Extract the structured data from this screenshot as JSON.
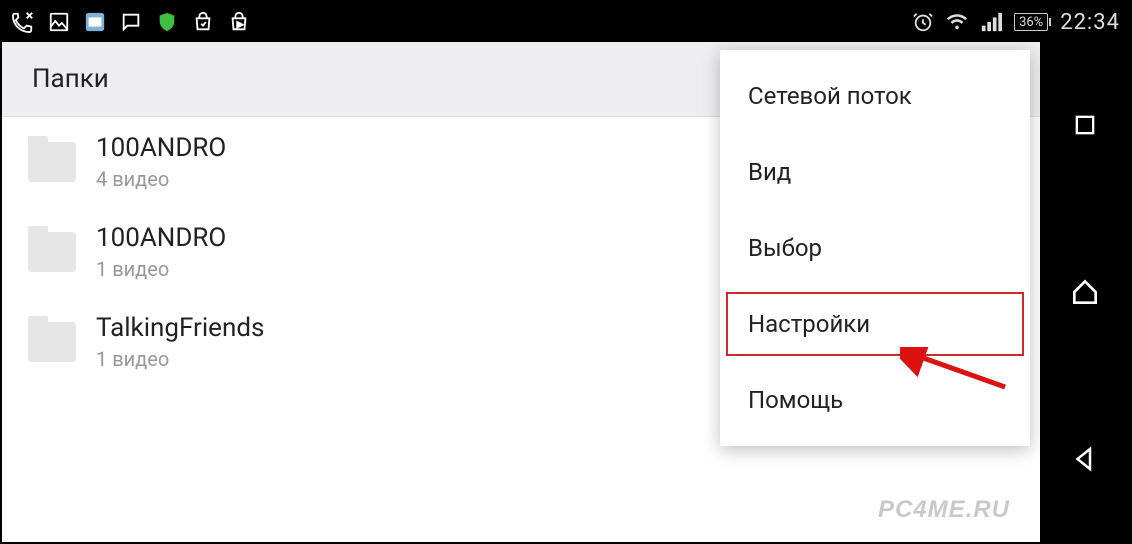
{
  "status": {
    "battery": "36%",
    "time": "22:34"
  },
  "header": {
    "title": "Папки"
  },
  "folders": [
    {
      "name": "100ANDRO",
      "sub": "4 видео"
    },
    {
      "name": "100ANDRO",
      "sub": "1 видео"
    },
    {
      "name": "TalkingFriends",
      "sub": "1 видео"
    }
  ],
  "menu": {
    "items": [
      {
        "label": "Сетевой поток",
        "highlight": false
      },
      {
        "label": "Вид",
        "highlight": false
      },
      {
        "label": "Выбор",
        "highlight": false
      },
      {
        "label": "Настройки",
        "highlight": true
      },
      {
        "label": "Помощь",
        "highlight": false
      }
    ]
  },
  "watermark": "PC4ME.RU"
}
